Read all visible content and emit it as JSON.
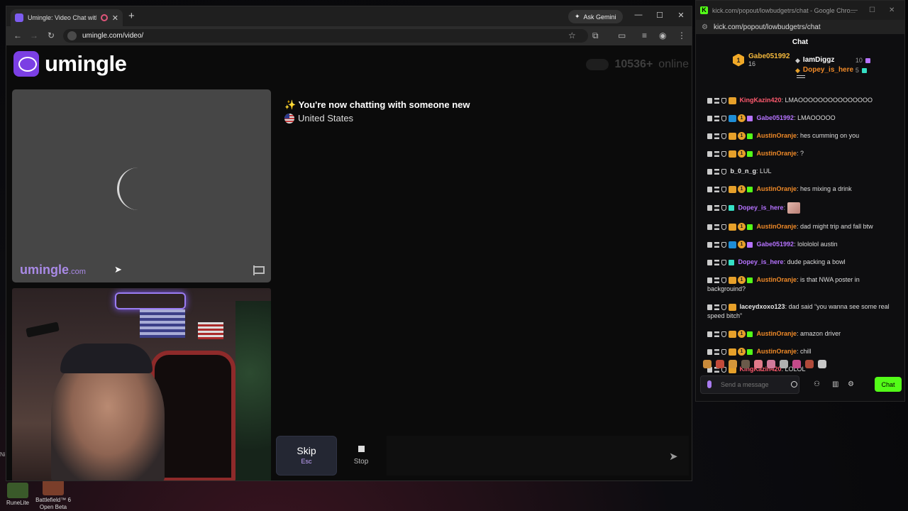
{
  "browser": {
    "tab_title": "Umingle: Video Chat with S",
    "new_tab_glyph": "+",
    "ask_gemini": "Ask Gemini",
    "url": "umingle.com/video/",
    "window_controls": [
      "—",
      "☐",
      "✕"
    ]
  },
  "umingle": {
    "brand": "umingle",
    "online_count": "10536+",
    "online_label": "online",
    "watermark_main": "umingle",
    "watermark_suffix": ".com",
    "status_message": "✨ You're now chatting with someone new",
    "country": "United States",
    "skip_label": "Skip",
    "skip_key": "Esc",
    "stop_label": "Stop",
    "message_placeholder": ""
  },
  "desktop": {
    "icons": [
      {
        "label": "RuneLite"
      },
      {
        "label": "Battlefield™ 6 Open Beta"
      }
    ],
    "stub_text": "Ni"
  },
  "popout": {
    "window_title": "kick.com/popout/lowbudgetrs/chat - Google Chro...",
    "url": "kick.com/popout/lowbudgetrs/chat",
    "header": "Chat",
    "leaderboard": {
      "top": {
        "name": "Gabe051992",
        "count": "16",
        "rank": "1"
      },
      "others": [
        {
          "name": "IamDiggz",
          "count": "10"
        },
        {
          "name": "Dopey_is_here",
          "count": "5"
        }
      ]
    },
    "messages": [
      {
        "user": "KingKazin420",
        "text": "LMAOOOOOOOOOOOOOOO",
        "color": "#ff5a6e"
      },
      {
        "user": "Gabe051992",
        "text": "LMAOOOOO",
        "color": "#b673ff"
      },
      {
        "user": "AustinOranje",
        "text": "hes cumming on you",
        "color": "#f08a28"
      },
      {
        "user": "AustinOranje",
        "text": "?",
        "color": "#f08a28"
      },
      {
        "user": "b_0_n_g",
        "text": "LUL",
        "color": "#e8e8e8"
      },
      {
        "user": "AustinOranje",
        "text": "hes mixing a drink",
        "color": "#f08a28"
      },
      {
        "user": "Dopey_is_here",
        "text": "",
        "color": "#b673ff"
      },
      {
        "user": "AustinOranje",
        "text": "dad might trip and fall btw",
        "color": "#f08a28"
      },
      {
        "user": "Gabe051992",
        "text": "lolololol austin",
        "color": "#b673ff"
      },
      {
        "user": "Dopey_is_here",
        "text": "dude packing a bowl",
        "color": "#b673ff"
      },
      {
        "user": "AustinOranje",
        "text": "is that NWA poster in backgrouind?",
        "color": "#f08a28"
      },
      {
        "user": "laceydxoxo123",
        "text": "dad said “you wanna see some real speed bitch”",
        "color": "#e8e8e8"
      },
      {
        "user": "AustinOranje",
        "text": "amazon driver",
        "color": "#f08a28"
      },
      {
        "user": "AustinOranje",
        "text": "chill",
        "color": "#f08a28"
      },
      {
        "user": "KingKazin420",
        "text": "LOLOL",
        "color": "#ff5a6e"
      }
    ],
    "input_placeholder": "Send a message",
    "send_label": "Chat"
  }
}
